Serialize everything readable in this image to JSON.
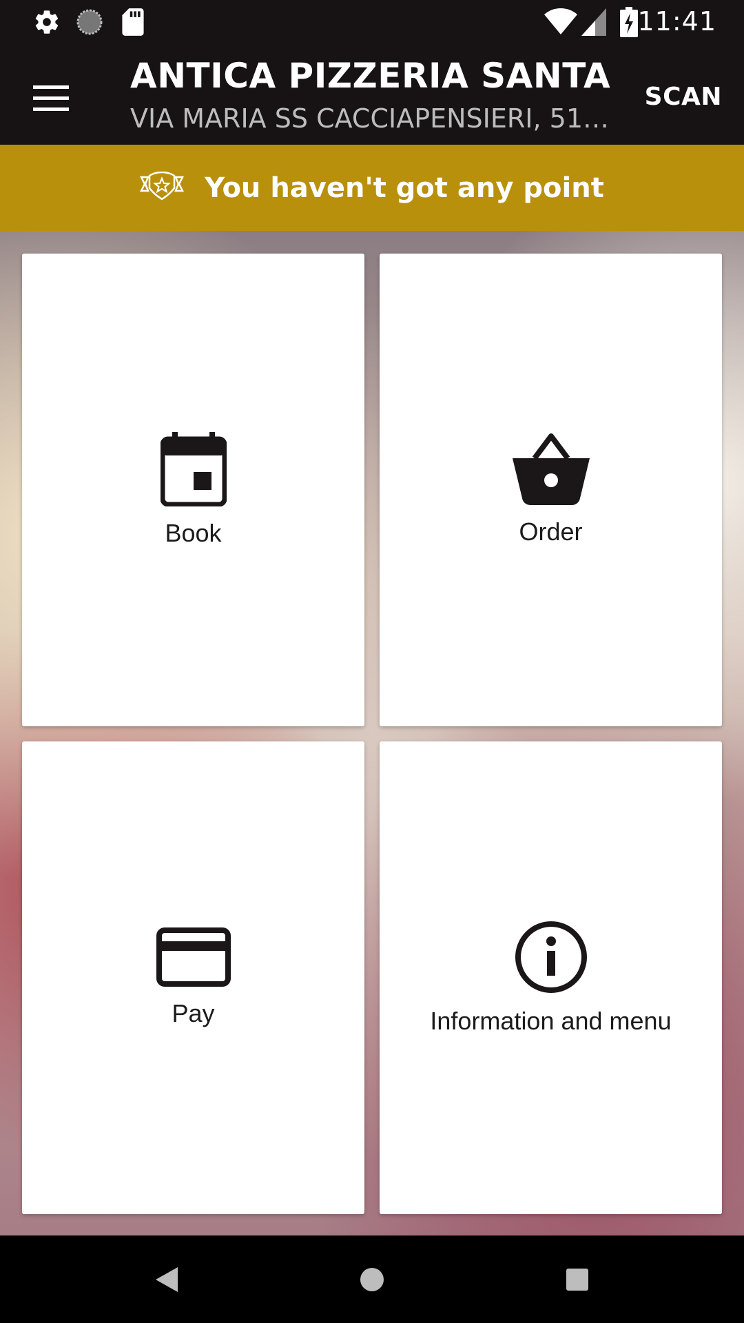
{
  "status_bar": {
    "time": "11:41",
    "icons": [
      "settings-icon",
      "loading-circle-icon",
      "sd-card-icon",
      "wifi-icon",
      "signal-icon",
      "battery-charging-icon"
    ]
  },
  "app_bar": {
    "title": "ANTICA PIZZERIA SANTA L…",
    "subtitle": "VIA MARIA SS CACCIAPENSIERI, 51…",
    "scan_label": "SCAN",
    "menu_icon": "hamburger-menu-icon"
  },
  "points_banner": {
    "icon": "star-ribbon-icon",
    "text": "You haven't got any point",
    "background": "#b8900c"
  },
  "tiles": [
    {
      "label": "Book",
      "icon": "calendar-icon"
    },
    {
      "label": "Order",
      "icon": "basket-icon"
    },
    {
      "label": "Pay",
      "icon": "credit-card-icon"
    },
    {
      "label": "Information and menu",
      "icon": "info-icon"
    }
  ],
  "nav_bar": {
    "icons": [
      "back-icon",
      "home-icon",
      "recents-icon"
    ]
  },
  "colors": {
    "header": "#171314",
    "accent": "#b8900c",
    "tile_bg": "#ffffff"
  }
}
